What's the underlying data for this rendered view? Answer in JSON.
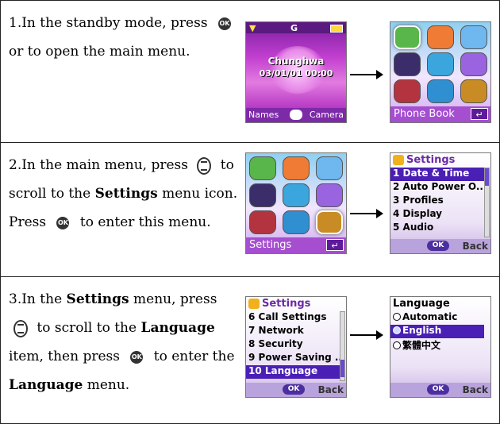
{
  "steps": [
    {
      "text": {
        "a": "1.In the standby mode, press ",
        "b": " or to open the main menu."
      },
      "standby": {
        "status_center": "G",
        "name": "Chunghwa",
        "datetime": "03/01/01 00:00",
        "soft_left": "Names",
        "soft_right": "Camera"
      },
      "menu": {
        "label": "Phone Book",
        "back": "↵"
      }
    },
    {
      "text": {
        "a": "2.In the main menu, press ",
        "b": " to scroll to the ",
        "bold": "Settings",
        "c": " menu icon. Press ",
        "d": " to enter this menu."
      },
      "menu": {
        "label": "Settings",
        "back": "↵"
      },
      "list": {
        "title": "Settings",
        "items": [
          "1 Date & Time",
          "2 Auto Power O...",
          "3 Profiles",
          "4 Display",
          "5 Audio"
        ],
        "ok": "OK",
        "back": "Back"
      }
    },
    {
      "text": {
        "a": "3.In the ",
        "bold1": "Settings",
        "b": " menu, press ",
        "c": " to scroll to the ",
        "bold2": "Language",
        "d": " item, then press ",
        "e": " to enter the ",
        "bold3": "Language",
        "f": " menu."
      },
      "list": {
        "title": "Settings",
        "items": [
          "6 Call Settings",
          "7 Network",
          "8 Security",
          "9 Power Saving ...",
          "10 Language"
        ],
        "ok": "OK",
        "back": "Back"
      },
      "language": {
        "title": "Language",
        "items": [
          "Automatic",
          "English",
          "繁體中文"
        ],
        "ok": "OK",
        "back": "Back"
      }
    }
  ],
  "key_label": "OK"
}
